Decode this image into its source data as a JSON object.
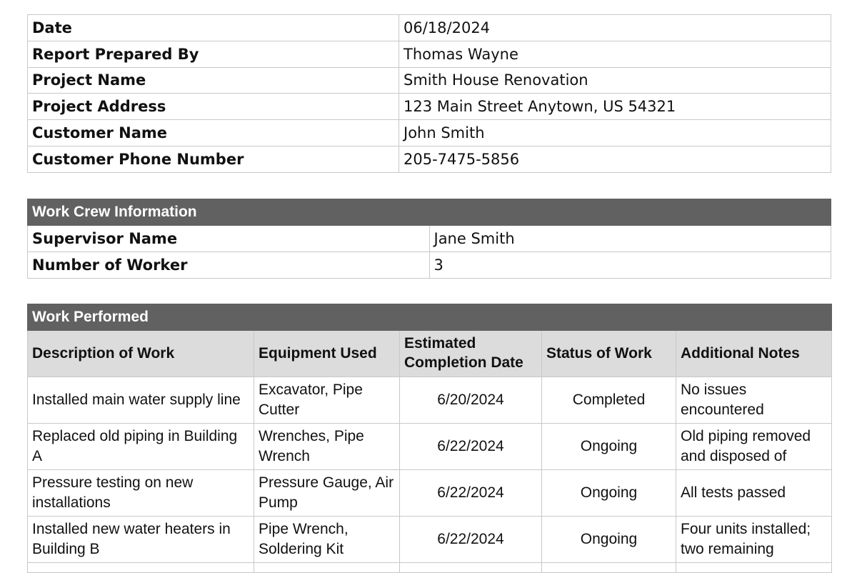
{
  "report_info": [
    {
      "label": "Date",
      "value": "06/18/2024"
    },
    {
      "label": "Report Prepared By",
      "value": "Thomas Wayne"
    },
    {
      "label": "Project Name",
      "value": "Smith House Renovation"
    },
    {
      "label": "Project Address",
      "value": "123 Main Street Anytown, US 54321"
    },
    {
      "label": "Customer Name",
      "value": "John Smith"
    },
    {
      "label": "Customer Phone Number",
      "value": "205-7475-5856"
    }
  ],
  "crew": {
    "title": "Work Crew Information",
    "rows": [
      {
        "label": "Supervisor Name",
        "value": "Jane Smith"
      },
      {
        "label": "Number of Worker",
        "value": "3"
      }
    ]
  },
  "work": {
    "title": "Work Performed",
    "columns": [
      "Description of Work",
      "Equipment Used",
      "Estimated Completion Date",
      "Status of Work",
      "Additional Notes"
    ],
    "rows": [
      {
        "description": "Installed main water supply line",
        "equipment": "Excavator, Pipe Cutter",
        "date": "6/20/2024",
        "status": "Completed",
        "notes": "No issues encountered"
      },
      {
        "description": "Replaced old piping in Building A",
        "equipment": "Wrenches, Pipe Wrench",
        "date": "6/22/2024",
        "status": "Ongoing",
        "notes": "Old piping removed and disposed of"
      },
      {
        "description": "Pressure testing on new installations",
        "equipment": "Pressure Gauge, Air Pump",
        "date": "6/22/2024",
        "status": "Ongoing",
        "notes": "All tests passed"
      },
      {
        "description": "Installed new water heaters in Building B",
        "equipment": "Pipe Wrench, Soldering Kit",
        "date": "6/22/2024",
        "status": "Ongoing",
        "notes": "Four units installed; two remaining"
      }
    ]
  }
}
